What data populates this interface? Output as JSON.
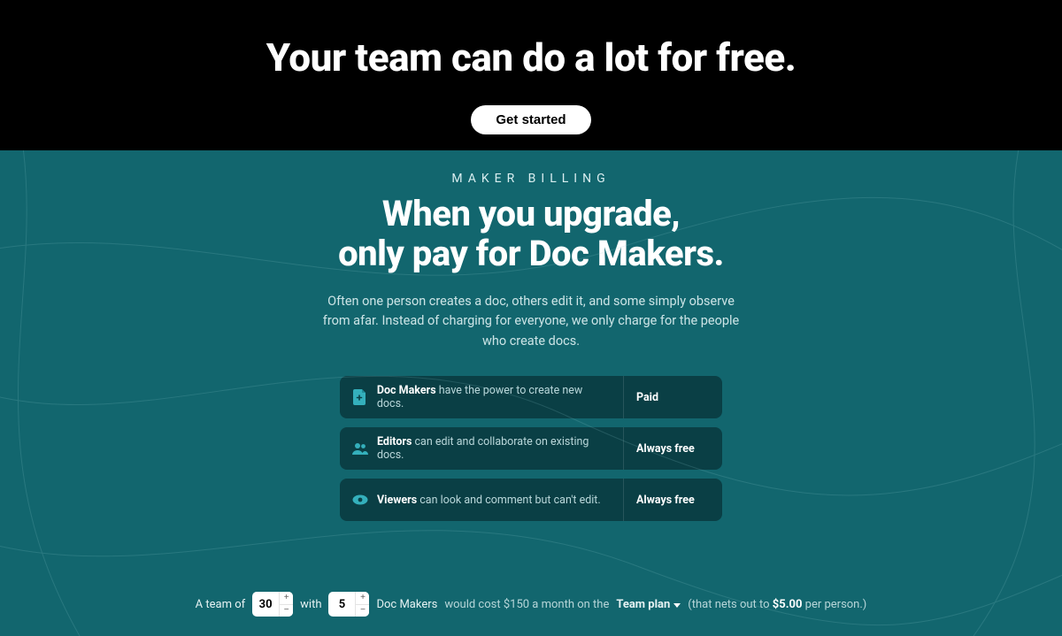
{
  "hero": {
    "headline": "Your team can do a lot for free.",
    "cta": "Get started"
  },
  "billing": {
    "eyebrow": "MAKER BILLING",
    "headline_line1": "When you upgrade,",
    "headline_line2": "only pay for Doc Makers.",
    "subhead": "Often one person creates a doc, others edit it, and some simply observe from afar. Instead of charging for everyone, we only charge for the people who create docs."
  },
  "roles": [
    {
      "name": "Doc Makers",
      "desc": " have the power to create new docs.",
      "price": "Paid",
      "icon": "doc-icon"
    },
    {
      "name": "Editors",
      "desc": " can edit and collaborate on existing docs.",
      "price": "Always free",
      "icon": "people-icon"
    },
    {
      "name": "Viewers",
      "desc": " can look and comment but can't edit.",
      "price": "Always free",
      "icon": "eye-icon"
    }
  ],
  "calculator": {
    "t1": "A team of",
    "team_size": "30",
    "t2": "with",
    "makers": "5",
    "t3": "Doc Makers",
    "t4": "would cost $150 a month on the",
    "plan": "Team plan",
    "t5": "(that nets out to",
    "per_person": "$5.00",
    "t6": "per person.)"
  }
}
